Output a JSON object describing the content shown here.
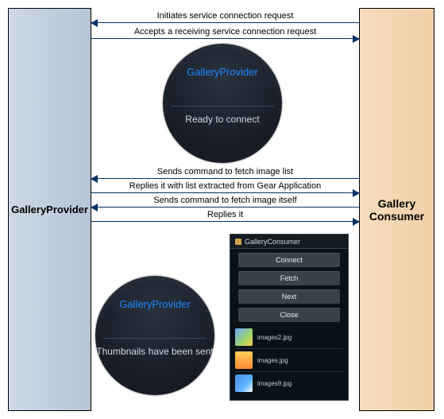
{
  "left_box": {
    "label": "GalleryProvider"
  },
  "right_box": {
    "label": "Gallery Consumer"
  },
  "arrows": {
    "a1": "Initiates service connection request",
    "a2": "Accepts a receiving service connection request",
    "a3": "Sends command to fetch image list",
    "a4": "Replies it with list extracted from Gear Application",
    "a5": "Sends command to fetch image itself",
    "a6": "Replies it"
  },
  "watch1": {
    "title": "GalleryProvider",
    "sub": "Ready to connect"
  },
  "watch2": {
    "title": "GalleryProvider",
    "sub": "Thumbnails have been sent"
  },
  "phone": {
    "title": "GalleryConsumer",
    "buttons": {
      "connect": "Connect",
      "fetch": "Fetch",
      "next": "Next",
      "close": "Close"
    },
    "files": {
      "f1": "images2.jpg",
      "f2": "images.jpg",
      "f3": "images9.jpg"
    }
  }
}
